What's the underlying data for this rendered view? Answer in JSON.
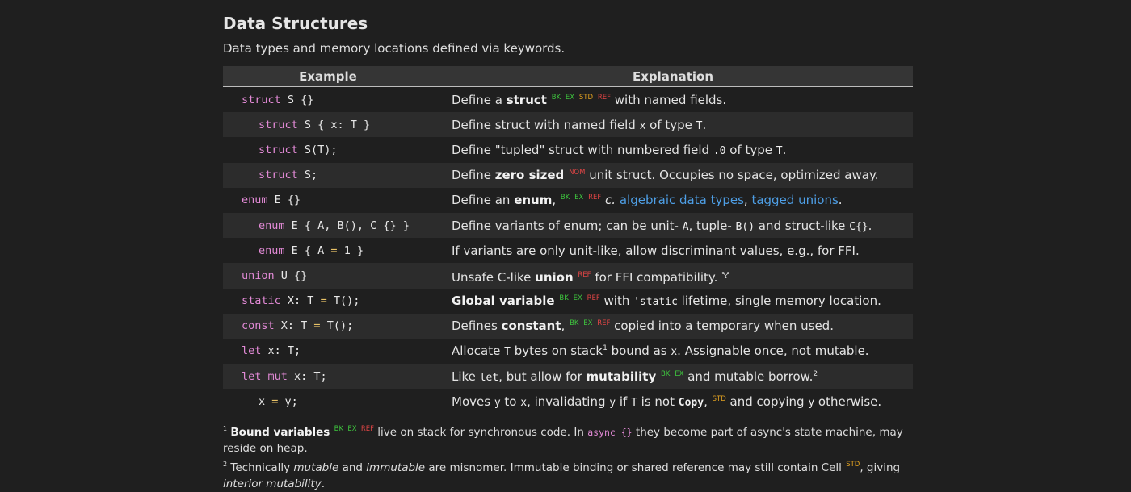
{
  "header": {
    "title": "Data Structures",
    "subtitle": "Data types and memory locations defined via keywords."
  },
  "table": {
    "col_example": "Example",
    "col_explanation": "Explanation"
  },
  "tags": {
    "bk": "BK",
    "ex": "EX",
    "std": "STD",
    "ref": "REF",
    "nom": "NOM"
  },
  "rows": {
    "r1": {
      "d1": "Define a ",
      "b": "struct",
      "d2": " with named fields."
    },
    "r2": {
      "d1": "Define struct with named field ",
      "c1": "x",
      "d2": " of type ",
      "c2": "T",
      "d3": "."
    },
    "r3": {
      "d1": "Define \"tupled\" struct with numbered field ",
      "c1": ".0",
      "d2": " of type ",
      "c2": "T",
      "d3": "."
    },
    "r4": {
      "d1": "Define ",
      "b": "zero sized",
      "d2": " unit struct. Occupies no space, optimized away."
    },
    "r5": {
      "d1": "Define an ",
      "b": "enum",
      "d2": ", ",
      "c": "c.",
      "l1": "algebraic data types",
      "sep": ", ",
      "l2": "tagged unions",
      "d3": "."
    },
    "r6": {
      "d1": "Define variants of enum; can be unit- ",
      "c1": "A",
      "d2": ", tuple- ",
      "c2": "B()",
      "d3": " and struct-like ",
      "c3": "C{}",
      "d4": "."
    },
    "r7": {
      "d1": "If variants are only unit-like, allow discriminant values, e.g., for FFI."
    },
    "r8": {
      "d1": "Unsafe C-like ",
      "b": "union",
      "d2": " for FFI compatibility. ",
      "icon": "🝖"
    },
    "r9": {
      "b": "Global variable",
      "d1": " with ",
      "c1": "'static",
      "d2": " lifetime, single memory location."
    },
    "r10": {
      "d1": "Defines ",
      "b": "constant",
      "d2": ",",
      "d3": " copied into a temporary when used."
    },
    "r11": {
      "d1": "Allocate ",
      "c1": "T",
      "d2": " bytes on stack",
      "sup": "1",
      "d3": " bound as ",
      "c2": "x",
      "d4": ". Assignable once, not mutable."
    },
    "r12": {
      "d1": "Like ",
      "c1": "let",
      "d2": ", but allow for ",
      "b": "mutability",
      "d3": " and mutable borrow.",
      "sup": "2"
    },
    "r13": {
      "d1": "Moves ",
      "c1": "y",
      "d2": " to ",
      "c2": "x",
      "d3": ", invalidating ",
      "c3": "y",
      "d4": " if ",
      "c4": "T",
      "d5": " is not ",
      "c5": "Copy",
      "d6": ",",
      "d7": " and copying ",
      "c6": "y",
      "d8": " otherwise."
    }
  },
  "footnotes": {
    "f1": {
      "num": "1",
      "b": "Bound variables",
      "t1": " live on stack for synchronous code. In ",
      "c": "async {}",
      "t2": " they become part of async's state machine, may reside on heap."
    },
    "f2": {
      "num": "2",
      "t1": " Technically ",
      "i1": "mutable",
      "t2": " and ",
      "i2": "immutable",
      "t3": " are misnomer. Immutable binding or shared reference may still contain Cell",
      "t4": ", giving ",
      "i3": "interior mutability",
      "t5": "."
    }
  }
}
